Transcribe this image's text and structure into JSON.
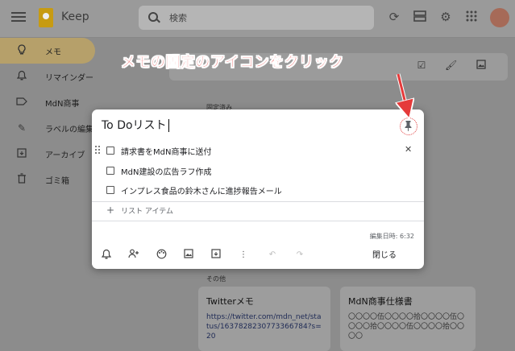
{
  "header": {
    "app_title": "Keep",
    "search_placeholder": "検索"
  },
  "sidebar": {
    "items": [
      {
        "label": "メモ",
        "icon": "lightbulb-icon",
        "active": true
      },
      {
        "label": "リマインダー",
        "icon": "bell-icon",
        "active": false
      },
      {
        "label": "MdN商事",
        "icon": "label-icon",
        "active": false
      },
      {
        "label": "ラベルの編集",
        "icon": "pencil-icon",
        "active": false
      },
      {
        "label": "アーカイブ",
        "icon": "archive-icon",
        "active": false
      },
      {
        "label": "ゴミ箱",
        "icon": "trash-icon",
        "active": false
      }
    ]
  },
  "background": {
    "pinned_label": "固定済み",
    "others_label": "その他",
    "cards": [
      {
        "title": "Twitterメモ",
        "body": "https://twitter.com/mdn_net/status/1637828230773366784?s=20"
      },
      {
        "title": "MdN商事仕様書",
        "body": "〇〇〇〇伍〇〇〇〇拾〇〇〇〇伍〇〇〇〇拾〇〇〇〇伍〇〇〇〇拾〇〇〇〇"
      }
    ]
  },
  "modal": {
    "title": "To Doリスト",
    "items": [
      {
        "text": "請求書をMdN商事に送付",
        "checked": false
      },
      {
        "text": "MdN建設の広告ラフ作成",
        "checked": false
      },
      {
        "text": "インプレス食品の鈴木さんに進捗報告メール",
        "checked": false
      }
    ],
    "add_item_label": "リスト アイテム",
    "edited_time": "編集日時: 6:32",
    "close_label": "閉じる"
  },
  "annotation": {
    "text": "メモの固定のアイコンをクリック",
    "color": "#e53a3a"
  }
}
